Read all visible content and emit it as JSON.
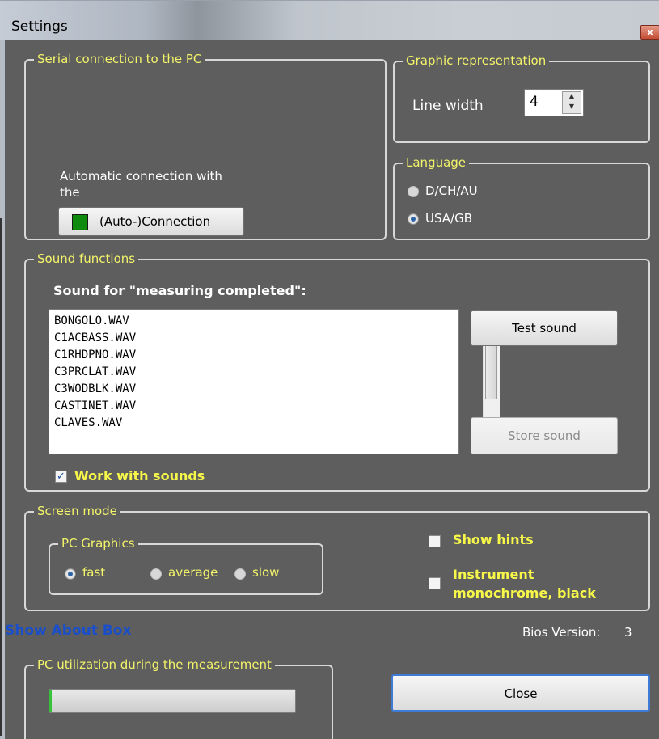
{
  "window": {
    "title": "Settings",
    "close_glyph": "x"
  },
  "serial": {
    "legend": "Serial connection to the PC",
    "auto_text": "Automatic connection with\nthe",
    "connect_button": "(Auto-)Connection"
  },
  "graphic": {
    "legend": "Graphic representation",
    "line_width_label": "Line width",
    "line_width_value": "4"
  },
  "language": {
    "legend": "Language",
    "options": [
      {
        "label": "D/CH/AU",
        "selected": false
      },
      {
        "label": "USA/GB",
        "selected": true
      }
    ]
  },
  "sound": {
    "legend": "Sound functions",
    "heading": "Sound for \"measuring completed\":",
    "files": [
      "BONGOLO.WAV",
      "C1ACBASS.WAV",
      "C1RHDPNO.WAV",
      "C3PRCLAT.WAV",
      "C3WODBLK.WAV",
      "CASTINET.WAV",
      "CLAVES.WAV"
    ],
    "test_button": "Test sound",
    "store_button": "Store sound",
    "work_with_sounds": "Work with sounds",
    "work_with_sounds_checked": true
  },
  "screen": {
    "legend": "Screen mode",
    "pc_graphics_legend": "PC Graphics",
    "options": [
      {
        "label": "fast",
        "selected": true
      },
      {
        "label": "average",
        "selected": false
      },
      {
        "label": "slow",
        "selected": false
      }
    ],
    "show_hints": "Show hints",
    "show_hints_checked": false,
    "instrument_line1": "Instrument",
    "instrument_line2": "monochrome, black",
    "instrument_checked": false
  },
  "footer": {
    "about_link": "Show About Box",
    "bios_label": "Bios Version:",
    "bios_value": "3",
    "utilization_legend": "PC utilization during the measurement",
    "utilization_fraction": 0.01,
    "close_button": "Close"
  },
  "colors": {
    "background": "#5e5e5e",
    "legend_text": "#f4f46a",
    "link": "#1a4fc9",
    "accent_green": "#0e8a0e"
  }
}
